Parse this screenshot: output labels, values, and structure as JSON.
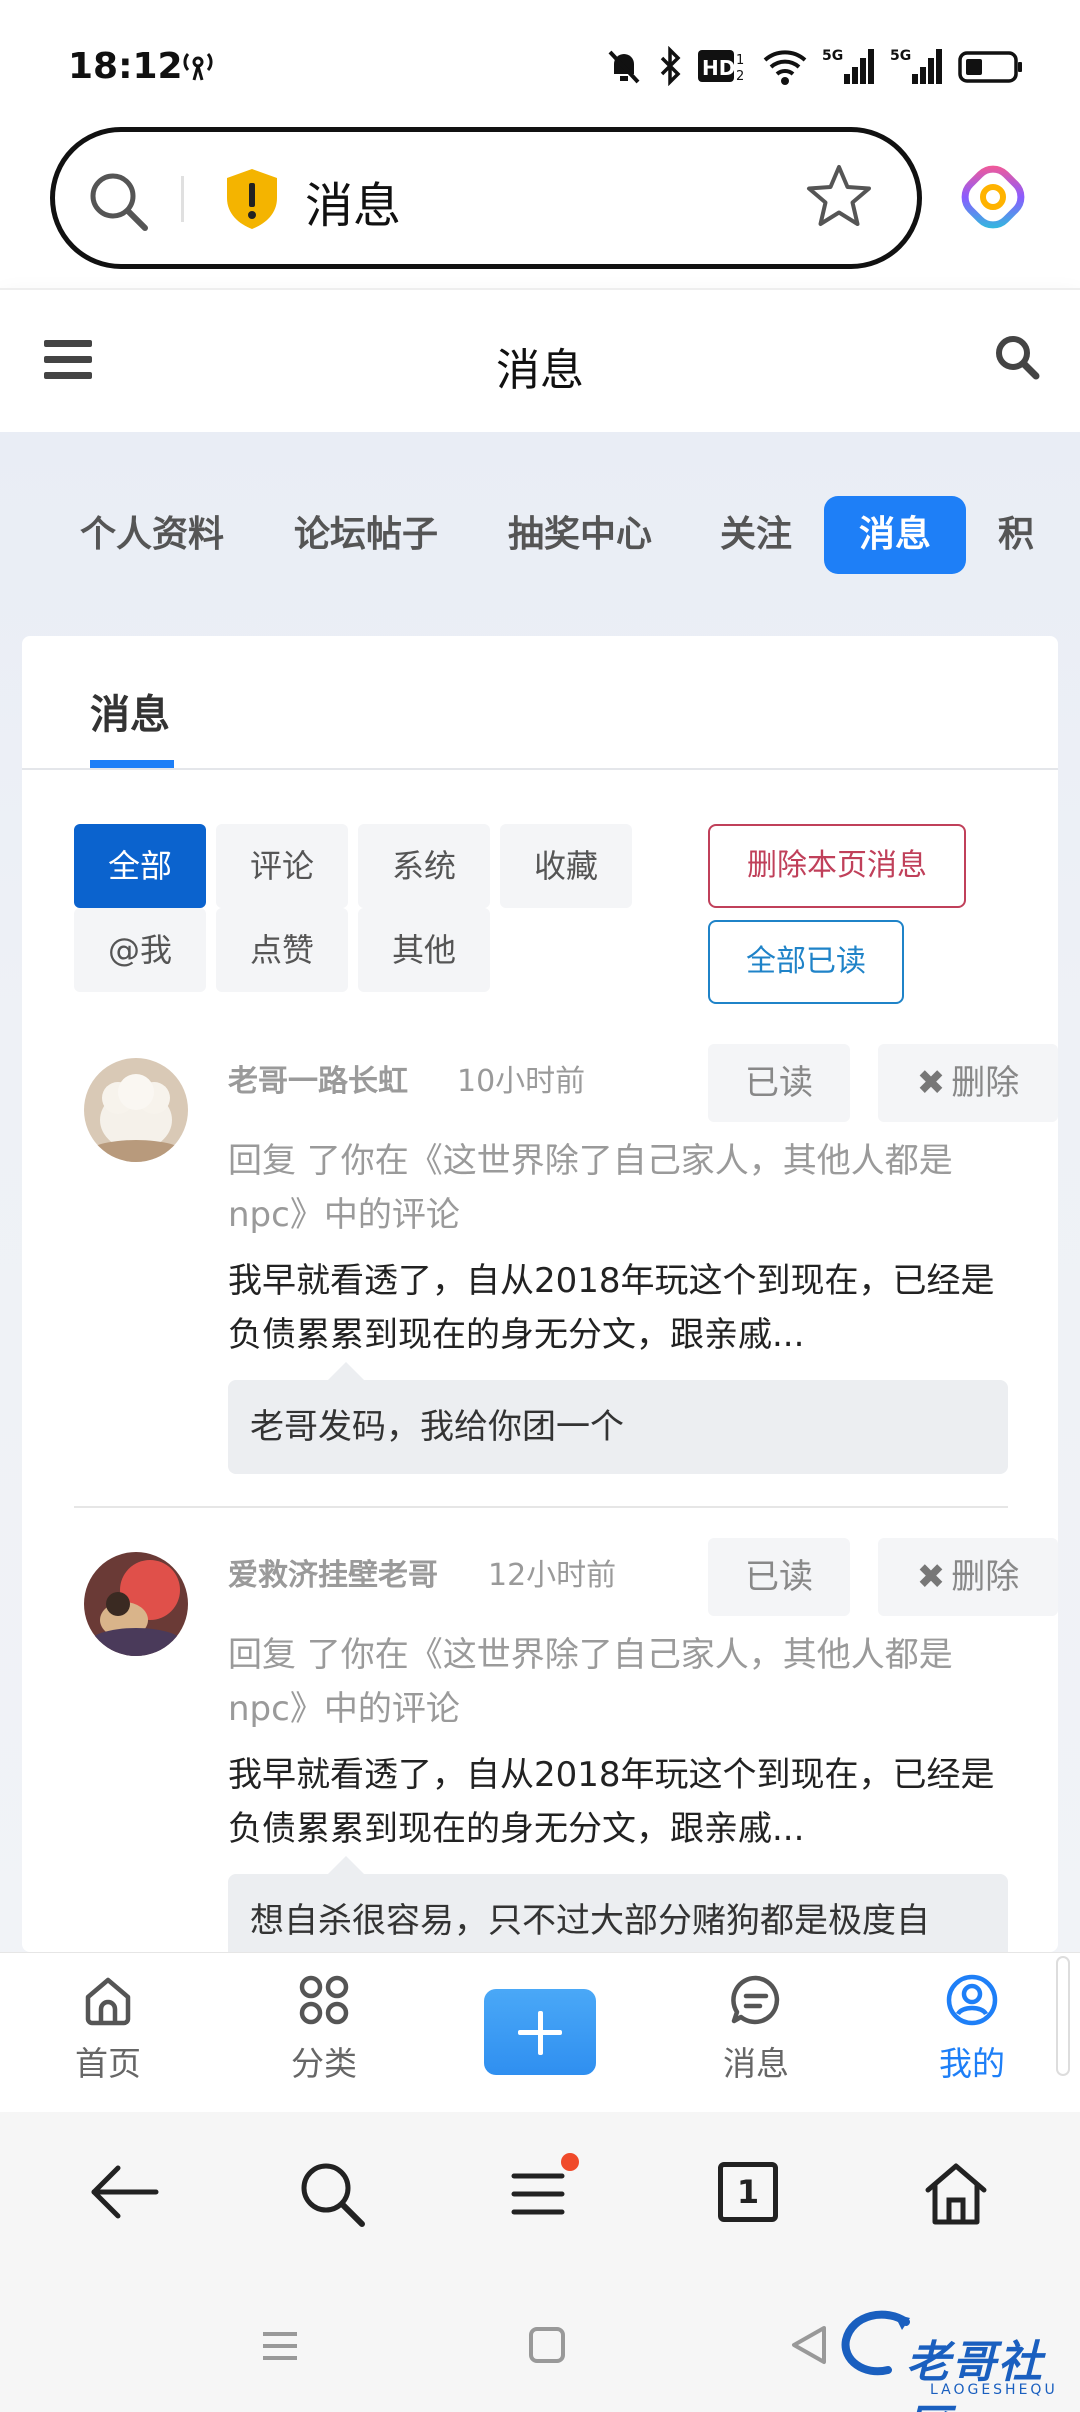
{
  "status": {
    "time": "18:12",
    "icons": [
      "hotspot-icon",
      "mute-bell-icon",
      "bluetooth-icon",
      "hd-icon",
      "wifi-icon",
      "signal-5g-icon",
      "signal-5g-icon",
      "battery-icon"
    ]
  },
  "browser": {
    "url_text": "消息",
    "tab_count": "1"
  },
  "site": {
    "title": "消息"
  },
  "profile_tabs": [
    {
      "label": "个人资料"
    },
    {
      "label": "论坛帖子"
    },
    {
      "label": "抽奖中心"
    },
    {
      "label": "关注"
    },
    {
      "label": "消息",
      "active": true
    },
    {
      "label": "积"
    }
  ],
  "card": {
    "tab_title": "消息",
    "filters": [
      "全部",
      "评论",
      "系统",
      "收藏",
      "@我",
      "点赞",
      "其他"
    ],
    "active_filter": "全部",
    "delete_page_label": "删除本页消息",
    "read_all_label": "全部已读"
  },
  "messages": [
    {
      "user": "老哥一路长虹",
      "time": "10小时前",
      "read_label": "已读",
      "delete_label": "删除",
      "reply": "回复 了你在《这世界除了自己家人，其他人都是npc》中的评论",
      "body": "我早就看透了，自从2018年玩这个到现在，已经是负债累累到现在的身无分文，跟亲戚...",
      "quote": "老哥发码，我给你团一个"
    },
    {
      "user": "爱救济挂壁老哥",
      "time": "12小时前",
      "read_label": "已读",
      "delete_label": "删除",
      "reply": "回复 了你在《这世界除了自己家人，其他人都是npc》中的评论",
      "body": "我早就看透了，自从2018年玩这个到现在，已经是负债累累到现在的身无分文，跟亲戚...",
      "quote": "想自杀很容易，只不过大部分赌狗都是极度自"
    }
  ],
  "site_nav": [
    {
      "label": "首页",
      "icon": "home-icon"
    },
    {
      "label": "分类",
      "icon": "grid-icon"
    },
    {
      "label": "",
      "icon": "plus-icon"
    },
    {
      "label": "消息",
      "icon": "chat-icon"
    },
    {
      "label": "我的",
      "icon": "user-circle-icon",
      "active": true
    }
  ],
  "watermark": {
    "text": "老哥社区",
    "sub": "LAOGESHEQU"
  },
  "colors": {
    "accent": "#1e7ff7",
    "filter_active": "#0b63ce",
    "danger": "#c0405a",
    "info": "#1f83c8"
  }
}
